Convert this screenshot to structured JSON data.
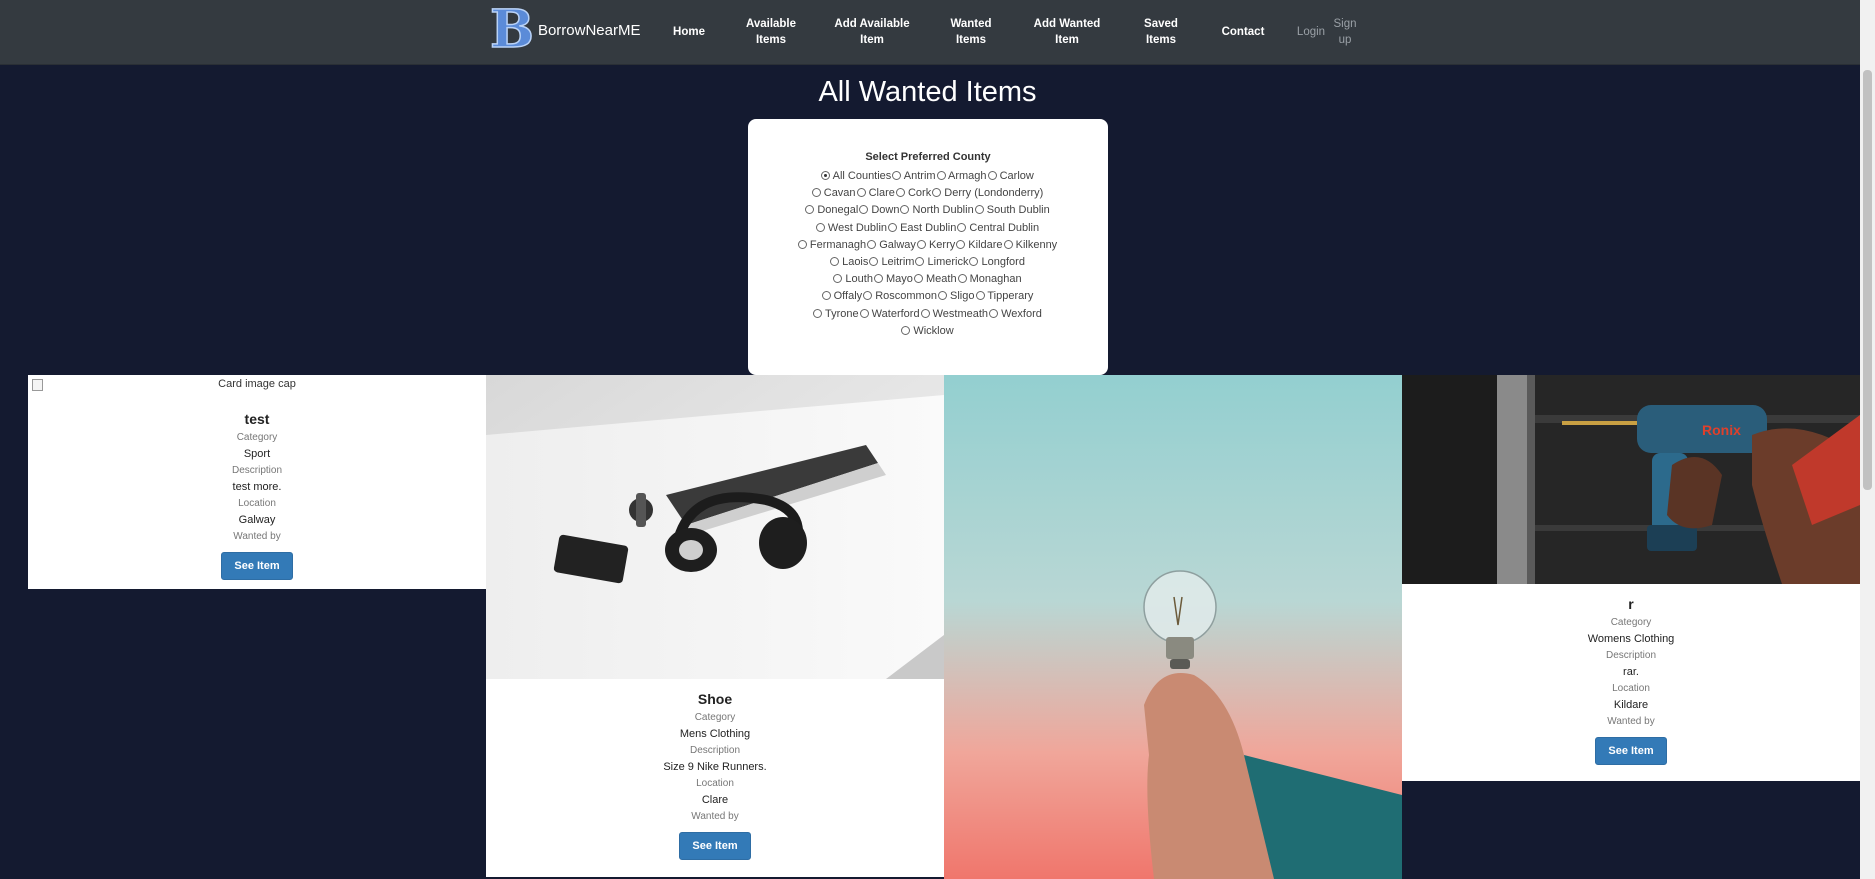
{
  "nav": {
    "brand_letter": "B",
    "brand_name": "BorrowNearME",
    "home": "Home",
    "available_items": "Available Items",
    "add_available_item": "Add Available Item",
    "wanted_items": "Wanted Items",
    "add_wanted_item": "Add Wanted Item",
    "saved_items": "Saved Items",
    "contact": "Contact",
    "login": "Login",
    "signup": "Sign up"
  },
  "page_title": "All Wanted Items",
  "county_filter": {
    "title": "Select Preferred County",
    "selected": "All Counties",
    "rows": [
      [
        "All Counties",
        "Antrim",
        "Armagh",
        "Carlow"
      ],
      [
        "Cavan",
        "Clare",
        "Cork",
        "Derry (Londonderry)"
      ],
      [
        "Donegal",
        "Down",
        "North Dublin",
        "South Dublin"
      ],
      [
        "West Dublin",
        "East Dublin",
        "Central Dublin"
      ],
      [
        "Fermanagh",
        "Galway",
        "Kerry",
        "Kildare",
        "Kilkenny"
      ],
      [
        "Laois",
        "Leitrim",
        "Limerick",
        "Longford"
      ],
      [
        "Louth",
        "Mayo",
        "Meath",
        "Monaghan"
      ],
      [
        "Offaly",
        "Roscommon",
        "Sligo",
        "Tipperary"
      ],
      [
        "Tyrone",
        "Waterford",
        "Westmeath",
        "Wexford"
      ],
      [
        "Wicklow"
      ]
    ]
  },
  "labels": {
    "category": "Category",
    "description": "Description",
    "location": "Location",
    "wanted_by": "Wanted by",
    "see_item": "See Item"
  },
  "cards": [
    {
      "image_alt": "Card image cap",
      "title": "test",
      "category": "Sport",
      "description": "test more.",
      "location": "Galway"
    },
    {
      "title": "Shoe",
      "category": "Mens Clothing",
      "description": "Size 9 Nike Runners.",
      "location": "Clare"
    },
    {},
    {
      "title": "r",
      "category": "Womens Clothing",
      "description": "rar.",
      "location": "Kildare"
    }
  ],
  "colors": {
    "page_bg": "#141a30",
    "navbar_bg": "#343a40",
    "button_bg": "#337ab7"
  }
}
